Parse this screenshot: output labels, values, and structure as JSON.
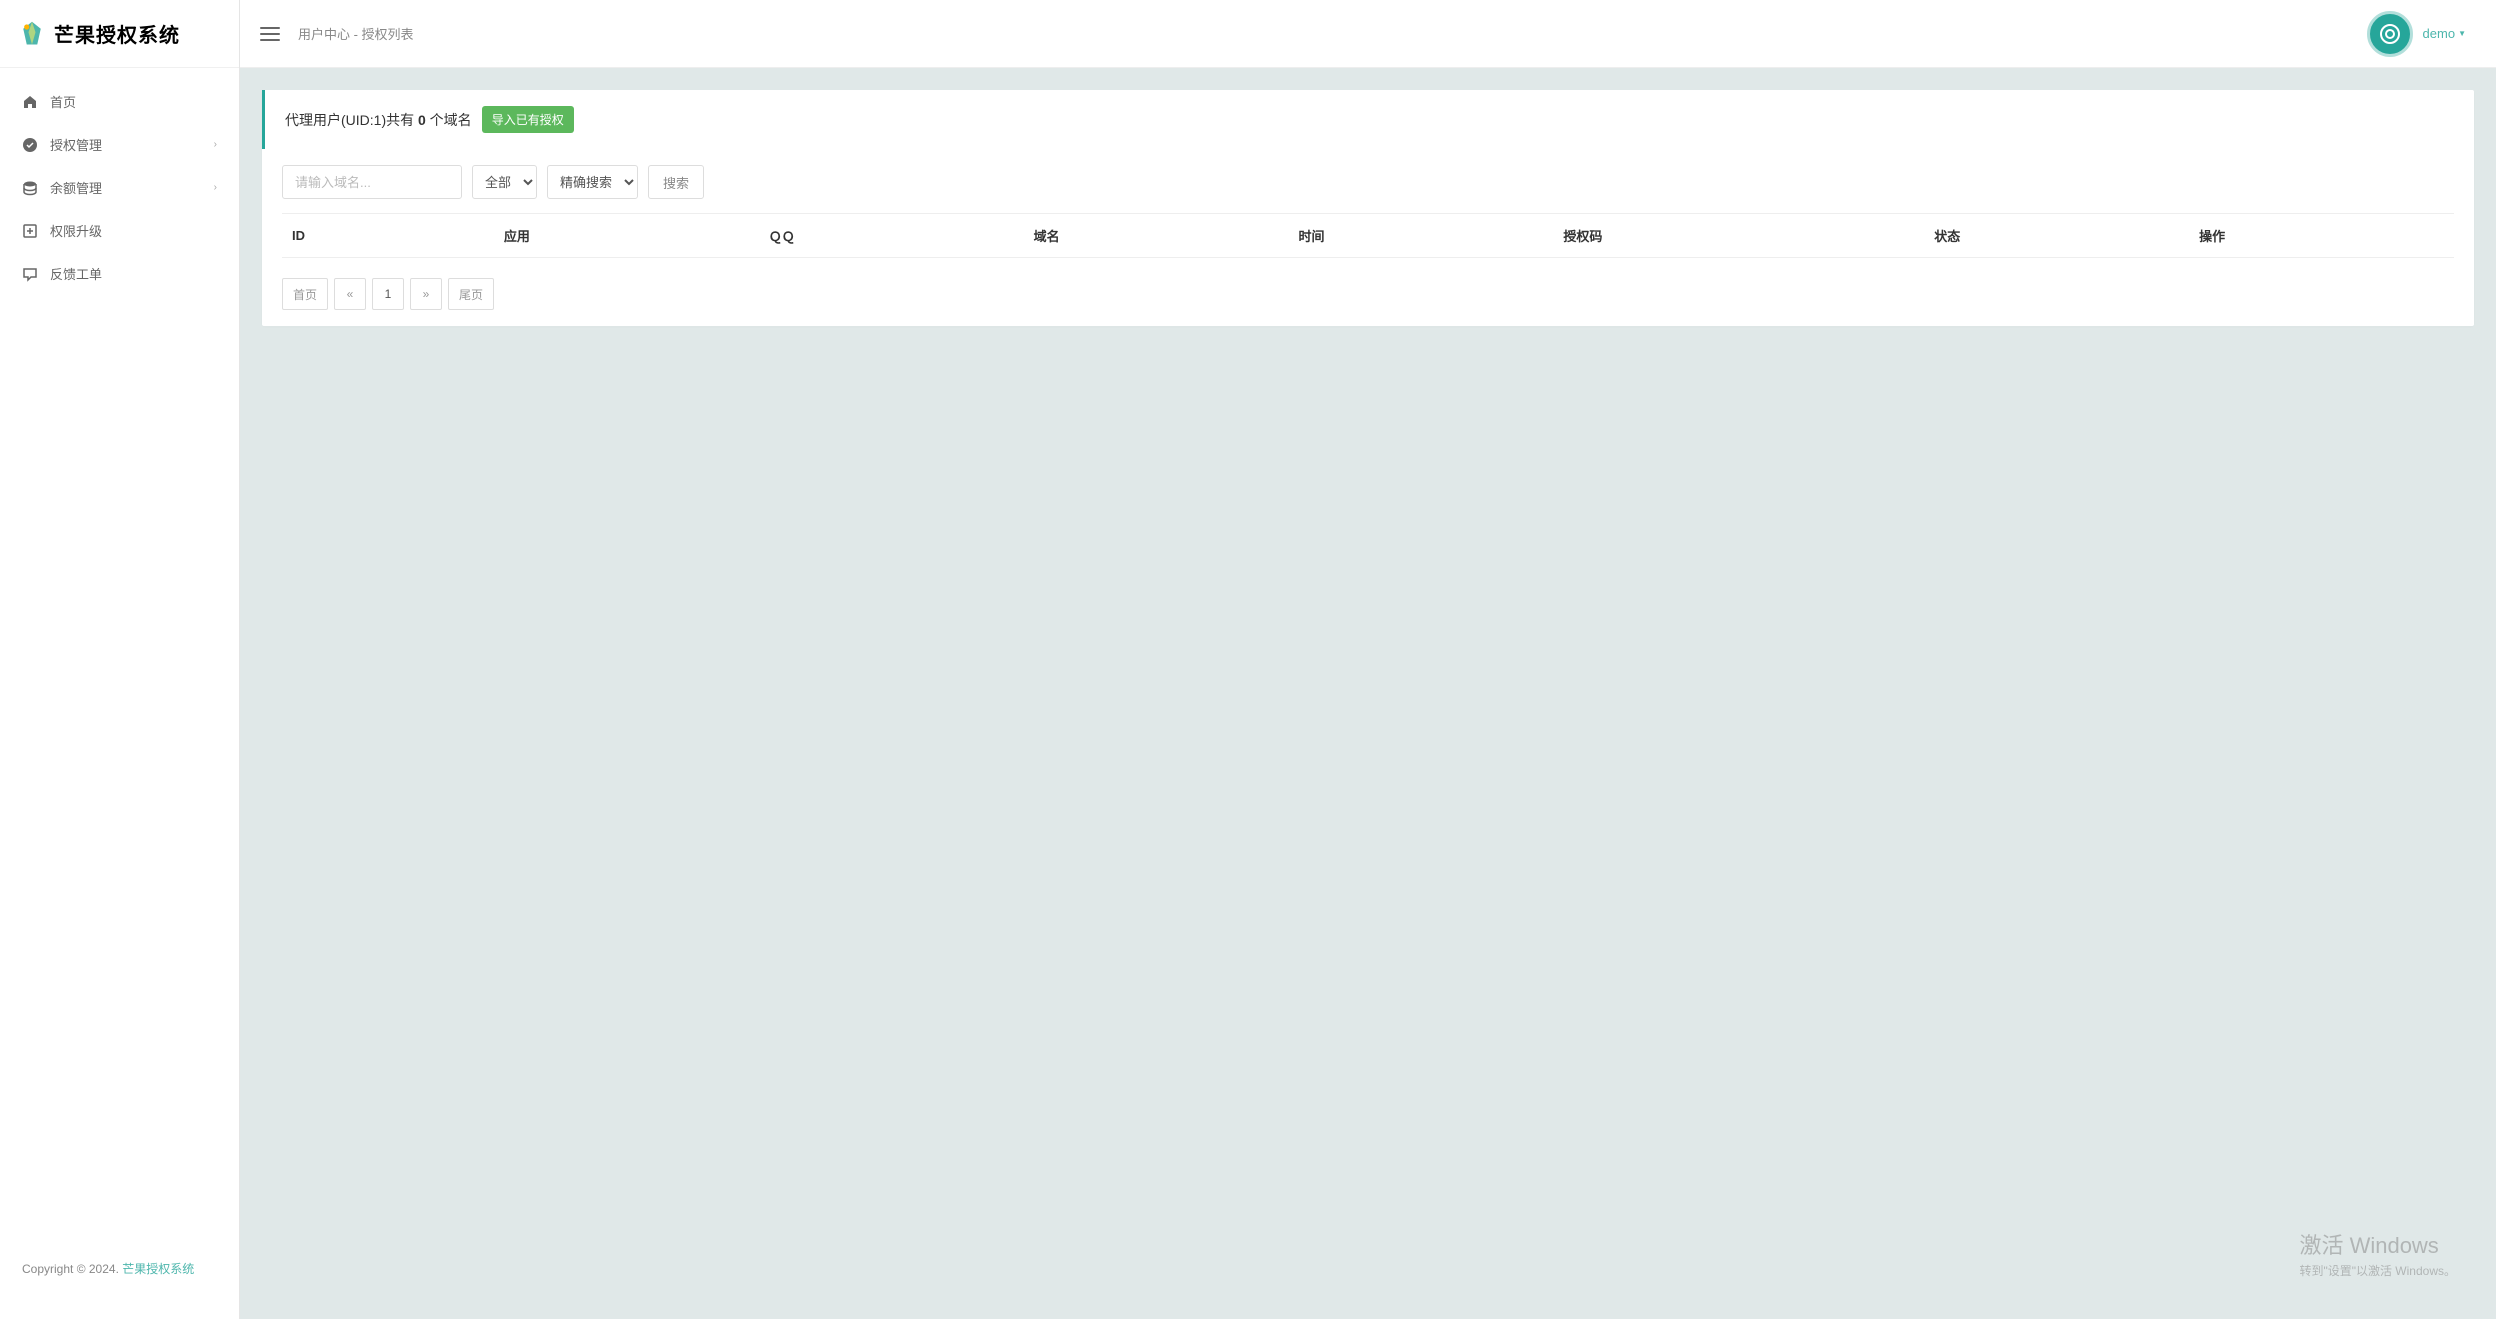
{
  "brand": {
    "name": "芒果授权系统"
  },
  "header": {
    "breadcrumb": "用户中心 - 授权列表",
    "username": "demo"
  },
  "sidebar": {
    "items": [
      {
        "label": "首页",
        "has_children": false
      },
      {
        "label": "授权管理",
        "has_children": true
      },
      {
        "label": "余额管理",
        "has_children": true
      },
      {
        "label": "权限升级",
        "has_children": false
      },
      {
        "label": "反馈工单",
        "has_children": false
      }
    ],
    "footer_prefix": "Copyright © 2024. ",
    "footer_link": "芒果授权系统"
  },
  "card": {
    "title_prefix": "代理用户(UID:1)共有 ",
    "title_count": "0",
    "title_suffix": " 个域名",
    "import_label": "导入已有授权"
  },
  "filters": {
    "domain_placeholder": "请输入域名...",
    "select_app": "全部",
    "select_mode": "精确搜索",
    "search_label": "搜索"
  },
  "table": {
    "columns": [
      "ID",
      "应用",
      "ＱＱ",
      "域名",
      "时间",
      "授权码",
      "状态",
      "操作"
    ],
    "rows": []
  },
  "pagination": {
    "first": "首页",
    "prev": "«",
    "pages": [
      "1"
    ],
    "next": "»",
    "last": "尾页"
  },
  "watermark": {
    "title": "激活 Windows",
    "sub": "转到\"设置\"以激活 Windows。"
  }
}
